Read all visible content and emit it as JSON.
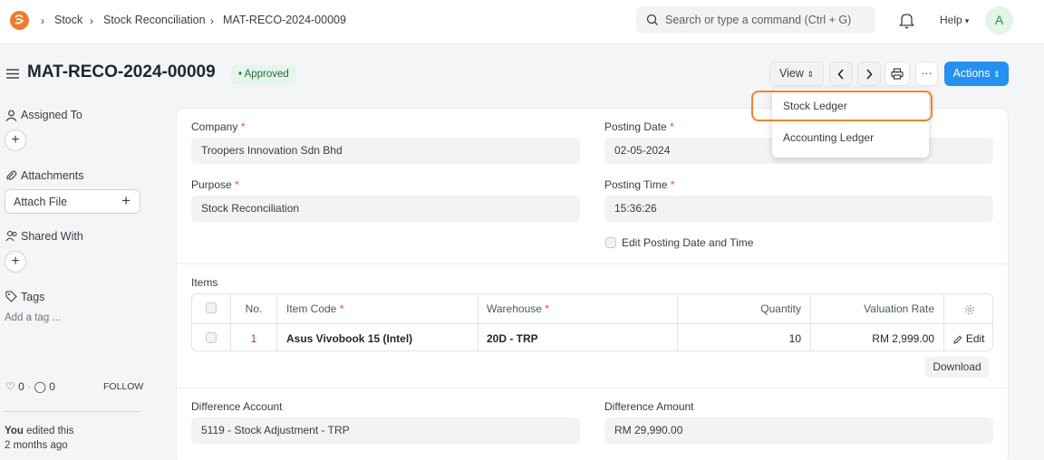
{
  "breadcrumbs": [
    "Stock",
    "Stock Reconciliation",
    "MAT-RECO-2024-00009"
  ],
  "search": {
    "placeholder": "Search or type a command (Ctrl + G)"
  },
  "help_label": "Help",
  "user_initial": "A",
  "doc": {
    "title": "MAT-RECO-2024-00009",
    "status": "Approved"
  },
  "toolbar": {
    "view_label": "View",
    "actions_label": "Actions",
    "more_label": "···"
  },
  "view_menu": [
    "Stock Ledger",
    "Accounting Ledger"
  ],
  "sidebar": {
    "assigned_to": "Assigned To",
    "attachments": "Attachments",
    "attach_file": "Attach File",
    "shared_with": "Shared With",
    "tags": "Tags",
    "add_tag": "Add a tag ...",
    "likes": "0",
    "comments": "0",
    "follow": "FOLLOW",
    "activity_user": "You",
    "activity_text": "edited this",
    "activity_time": "2 months ago"
  },
  "form": {
    "company_label": "Company",
    "company_value": "Troopers Innovation Sdn Bhd",
    "posting_date_label": "Posting Date",
    "posting_date_value": "02-05-2024",
    "purpose_label": "Purpose",
    "purpose_value": "Stock Reconciliation",
    "posting_time_label": "Posting Time",
    "posting_time_value": "15:36:26",
    "edit_posting_label": "Edit Posting Date and Time",
    "items_label": "Items",
    "difference_account_label": "Difference Account",
    "difference_account_value": "5119 - Stock Adjustment - TRP",
    "difference_amount_label": "Difference Amount",
    "difference_amount_value": "RM 29,990.00"
  },
  "items_table": {
    "columns": [
      "No.",
      "Item Code",
      "Warehouse",
      "Quantity",
      "Valuation Rate"
    ],
    "rows": [
      {
        "no": "1",
        "item_code": "Asus Vivobook 15 (Intel)",
        "warehouse": "20D - TRP",
        "quantity": "10",
        "valuation_rate": "RM 2,999.00",
        "edit": "Edit"
      }
    ],
    "download_label": "Download"
  },
  "required_marker": "*",
  "colors": {
    "primary": "#2490ef",
    "approved_bg": "#e4f5e9",
    "highlight": "#f0842e",
    "logo": "#f07a2e"
  }
}
